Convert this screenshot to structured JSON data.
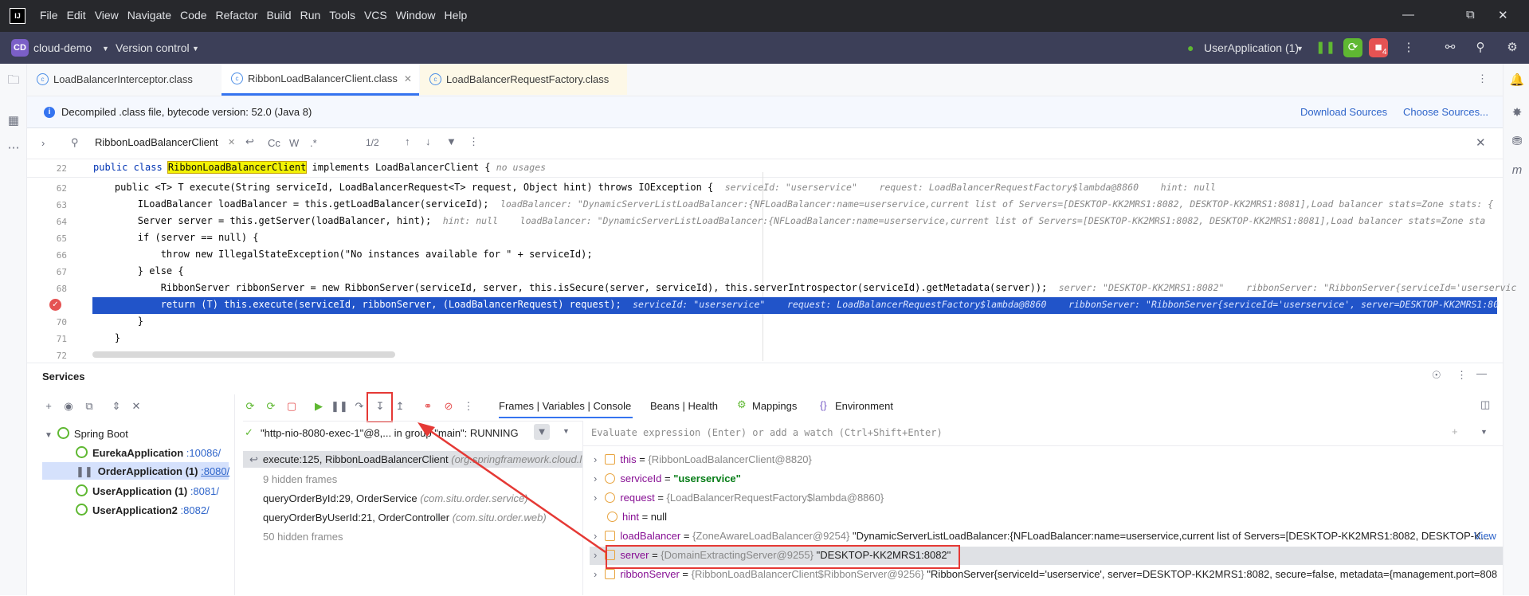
{
  "menu": [
    "File",
    "Edit",
    "View",
    "Navigate",
    "Code",
    "Refactor",
    "Build",
    "Run",
    "Tools",
    "VCS",
    "Window",
    "Help"
  ],
  "project": {
    "badge": "CD",
    "name": "cloud-demo",
    "vcs": "Version control"
  },
  "run_config": "UserApplication (1)",
  "stop_badge": "4",
  "tabs": [
    {
      "label": "LoadBalancerInterceptor.class"
    },
    {
      "label": "RibbonLoadBalancerClient.class"
    },
    {
      "label": "LoadBalancerRequestFactory.class"
    }
  ],
  "banner": {
    "text": "Decompiled .class file, bytecode version: 52.0 (Java 8)",
    "download": "Download Sources",
    "choose": "Choose Sources..."
  },
  "search": {
    "query": "RibbonLoadBalancerClient",
    "count": "1/2",
    "cc": "Cc",
    "w": "W",
    "regex": ".*"
  },
  "code": {
    "sticky": {
      "num": "22",
      "pre": "public class ",
      "cls": "RibbonLoadBalancerClient",
      "post": " implements LoadBalancerClient {",
      "hint": "no usages"
    },
    "lines": [
      {
        "num": "62",
        "text": "    public <T> T execute(String serviceId, LoadBalancerRequest<T> request, Object hint) throws IOException {",
        "hint": "serviceId: \"userservice\"    request: LoadBalancerRequestFactory$lambda@8860    hint: null"
      },
      {
        "num": "63",
        "text": "        ILoadBalancer loadBalancer = this.getLoadBalancer(serviceId);",
        "hint": "loadBalancer: \"DynamicServerListLoadBalancer:{NFLoadBalancer:name=userservice,current list of Servers=[DESKTOP-KK2MRS1:8082, DESKTOP-KK2MRS1:8081],Load balancer stats=Zone stats: {"
      },
      {
        "num": "64",
        "text": "        Server server = this.getServer(loadBalancer, hint);",
        "hint": "hint: null    loadBalancer: \"DynamicServerListLoadBalancer:{NFLoadBalancer:name=userservice,current list of Servers=[DESKTOP-KK2MRS1:8082, DESKTOP-KK2MRS1:8081],Load balancer stats=Zone sta"
      },
      {
        "num": "65",
        "text": "        if (server == null) {",
        "hint": ""
      },
      {
        "num": "66",
        "text": "            throw new IllegalStateException(\"No instances available for \" + serviceId);",
        "hint": ""
      },
      {
        "num": "67",
        "text": "        } else {",
        "hint": ""
      },
      {
        "num": "68",
        "text": "            RibbonServer ribbonServer = new RibbonServer(serviceId, server, this.isSecure(server, serviceId), this.serverIntrospector(serviceId).getMetadata(server));",
        "hint": "server: \"DESKTOP-KK2MRS1:8082\"    ribbonServer: \"RibbonServer{serviceId='userservic"
      },
      {
        "num": "69",
        "text": "            return (T) this.execute(serviceId, ribbonServer, (LoadBalancerRequest) request);",
        "hint": "serviceId: \"userservice\"    request: LoadBalancerRequestFactory$lambda@8860    ribbonServer: \"RibbonServer{serviceId='userservice', server=DESKTOP-KK2MRS1:80"
      },
      {
        "num": "70",
        "text": "        }",
        "hint": ""
      },
      {
        "num": "71",
        "text": "    }",
        "hint": ""
      },
      {
        "num": "72",
        "text": "",
        "hint": ""
      }
    ]
  },
  "services": {
    "title": "Services",
    "root": "Spring Boot",
    "apps": [
      {
        "name": "EurekaApplication",
        "port": ":10086/"
      },
      {
        "name": "OrderApplication (1)",
        "port": ":8080/"
      },
      {
        "name": "UserApplication (1)",
        "port": ":8081/"
      },
      {
        "name": "UserApplication2",
        "port": ":8082/"
      }
    ]
  },
  "debug": {
    "tabs": [
      "Frames | Variables | Console",
      "Beans | Health",
      "Mappings",
      "Environment"
    ],
    "thread": "\"http-nio-8080-exec-1\"@8,... in group \"main\": RUNNING",
    "eval_placeholder": "Evaluate expression (Enter) or add a watch (Ctrl+Shift+Enter)",
    "frames": [
      {
        "method": "execute:125, RibbonLoadBalancerClient",
        "pkg": "(org.springframework.cloud.l"
      },
      {
        "method": "9 hidden frames",
        "pkg": ""
      },
      {
        "method": "queryOrderById:29, OrderService",
        "pkg": "(com.situ.order.service)"
      },
      {
        "method": "queryOrderByUserId:21, OrderController",
        "pkg": "(com.situ.order.web)"
      },
      {
        "method": "50 hidden frames",
        "pkg": ""
      }
    ],
    "vars": [
      {
        "name": "this",
        "ref": "{RibbonLoadBalancerClient@8820}",
        "val": ""
      },
      {
        "name": "serviceId",
        "ref": "",
        "val": "\"userservice\""
      },
      {
        "name": "request",
        "ref": "{LoadBalancerRequestFactory$lambda@8860}",
        "val": ""
      },
      {
        "name": "hint",
        "ref": "",
        "val": "null"
      },
      {
        "name": "loadBalancer",
        "ref": "{ZoneAwareLoadBalancer@9254}",
        "val": "\"DynamicServerListLoadBalancer:{NFLoadBalancer:name=userservice,current list of Servers=[DESKTOP-KK2MRS1:8082, DESKTOP-K..."
      },
      {
        "name": "server",
        "ref": "{DomainExtractingServer@9255}",
        "val": "\"DESKTOP-KK2MRS1:8082\""
      },
      {
        "name": "ribbonServer",
        "ref": "{RibbonLoadBalancerClient$RibbonServer@9256}",
        "val": "\"RibbonServer{serviceId='userservice', server=DESKTOP-KK2MRS1:8082, secure=false, metadata={management.port=808"
      }
    ],
    "view_link": "View"
  }
}
